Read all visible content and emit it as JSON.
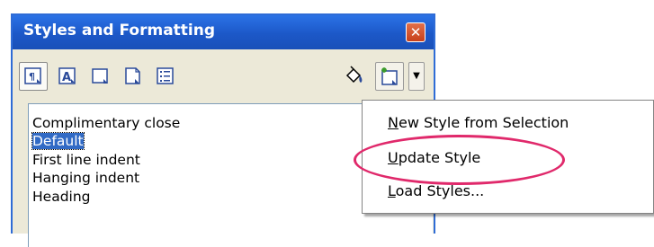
{
  "window": {
    "title": "Styles and Formatting",
    "close_label": "✕"
  },
  "toolbar": {
    "buttons": [
      {
        "icon": "paragraph-styles-icon",
        "state": "pressed"
      },
      {
        "icon": "character-styles-icon",
        "state": "normal"
      },
      {
        "icon": "frame-styles-icon",
        "state": "normal"
      },
      {
        "icon": "page-styles-icon",
        "state": "normal"
      },
      {
        "icon": "list-styles-icon",
        "state": "normal"
      }
    ],
    "fill_format_icon": "fill-format-mode-icon",
    "new_style_icon": "new-style-from-selection-icon",
    "dropdown_glyph": "▼"
  },
  "styles_list": {
    "items": [
      {
        "label": "Complimentary close",
        "selected": false
      },
      {
        "label": "Default",
        "selected": true
      },
      {
        "label": "First line indent",
        "selected": false
      },
      {
        "label": "Hanging indent",
        "selected": false
      },
      {
        "label": "Heading",
        "selected": false
      }
    ]
  },
  "context_menu": {
    "items": [
      {
        "label": "New Style from Selection",
        "mnemonic": "N"
      },
      {
        "label": "Update Style",
        "mnemonic": "U",
        "highlighted_annotation": true
      },
      {
        "label": "Load Styles...",
        "mnemonic": "L"
      }
    ]
  },
  "colors": {
    "titlebar": "#1c58c8",
    "selection": "#316ac5",
    "annotation": "#e0296b",
    "close_button": "#c8401a"
  }
}
